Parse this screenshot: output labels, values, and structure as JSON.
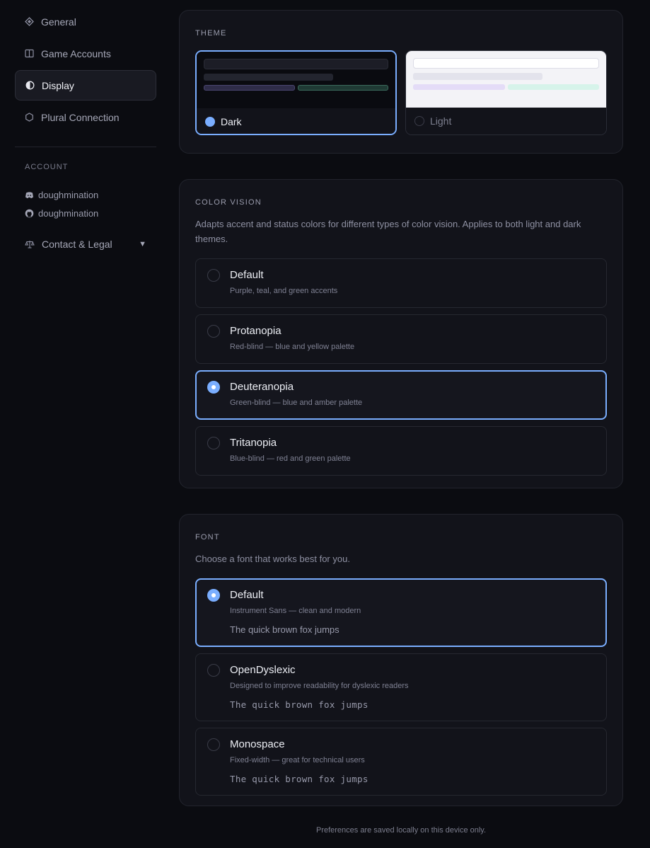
{
  "sidebar": {
    "items": [
      {
        "label": "General",
        "icon": "diamond-icon"
      },
      {
        "label": "Game Accounts",
        "icon": "panel-icon"
      },
      {
        "label": "Display",
        "icon": "contrast-icon"
      },
      {
        "label": "Plural Connection",
        "icon": "hexagon-icon"
      }
    ],
    "account_label": "ACCOUNT",
    "discord_user": "doughmination",
    "github_user": "doughmination",
    "legal_label": "Contact & Legal"
  },
  "theme": {
    "title": "THEME",
    "dark_label": "Dark",
    "light_label": "Light",
    "selected": "Dark"
  },
  "color_vision": {
    "title": "COLOR VISION",
    "description": "Adapts accent and status colors for different types of color vision. Applies to both light and dark themes.",
    "options": [
      {
        "title": "Default",
        "subtitle": "Purple, teal, and green accents"
      },
      {
        "title": "Protanopia",
        "subtitle": "Red-blind — blue and yellow palette"
      },
      {
        "title": "Deuteranopia",
        "subtitle": "Green-blind — blue and amber palette"
      },
      {
        "title": "Tritanopia",
        "subtitle": "Blue-blind — red and green palette"
      }
    ],
    "selected": "Deuteranopia"
  },
  "font": {
    "title": "FONT",
    "description": "Choose a font that works best for you.",
    "options": [
      {
        "title": "Default",
        "subtitle": "Instrument Sans — clean and modern",
        "sample": "The quick brown fox jumps"
      },
      {
        "title": "OpenDyslexic",
        "subtitle": "Designed to improve readability for dyslexic readers",
        "sample": "The quick brown fox jumps"
      },
      {
        "title": "Monospace",
        "subtitle": "Fixed-width — great for technical users",
        "sample": "The quick brown fox jumps"
      }
    ],
    "selected": "Default"
  },
  "footer_note": "Preferences are saved locally on this device only.",
  "colors": {
    "accent": "#7aaeff",
    "background": "#0b0c11",
    "card": "#12131a"
  }
}
